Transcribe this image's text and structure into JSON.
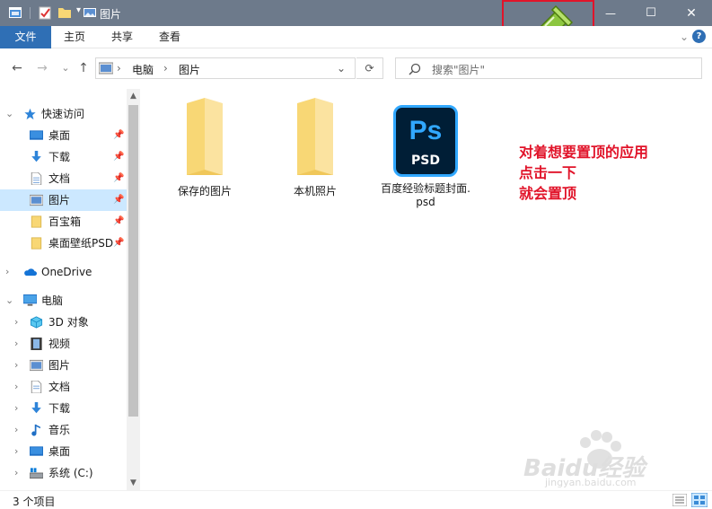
{
  "window": {
    "title": "图片",
    "controls": {
      "minimize": "—",
      "maximize": "☐",
      "close": "✕"
    }
  },
  "ribbon": {
    "tabs": [
      {
        "label": "文件",
        "active": true
      },
      {
        "label": "主页"
      },
      {
        "label": "共享"
      },
      {
        "label": "查看"
      }
    ],
    "collapse_glyph": "⌄",
    "help_glyph": "?"
  },
  "navigation": {
    "back": "←",
    "forward": "→",
    "recent": "⌄",
    "up": "↑",
    "breadcrumb": [
      "电脑",
      "图片"
    ],
    "separator": "›",
    "dropdown": "⌄",
    "refresh": "⟳"
  },
  "search": {
    "placeholder": "搜索\"图片\""
  },
  "sidebar": {
    "quick_access": {
      "label": "快速访问",
      "items": [
        {
          "label": "桌面",
          "icon": "desktop-icon",
          "pinned": true
        },
        {
          "label": "下载",
          "icon": "download-icon",
          "pinned": true
        },
        {
          "label": "文档",
          "icon": "document-icon",
          "pinned": true
        },
        {
          "label": "图片",
          "icon": "pictures-icon",
          "pinned": true,
          "selected": true
        },
        {
          "label": "百宝箱",
          "icon": "folder-icon",
          "pinned": true
        },
        {
          "label": "桌面壁纸PSD",
          "icon": "folder-icon",
          "pinned": true
        }
      ]
    },
    "onedrive": {
      "label": "OneDrive"
    },
    "this_pc": {
      "label": "电脑",
      "items": [
        {
          "label": "3D 对象",
          "icon": "3d-objects-icon"
        },
        {
          "label": "视频",
          "icon": "video-icon"
        },
        {
          "label": "图片",
          "icon": "pictures-icon"
        },
        {
          "label": "文档",
          "icon": "document-icon"
        },
        {
          "label": "下载",
          "icon": "download-icon"
        },
        {
          "label": "音乐",
          "icon": "music-icon"
        },
        {
          "label": "桌面",
          "icon": "desktop-icon"
        },
        {
          "label": "系统 (C:)",
          "icon": "drive-icon"
        }
      ]
    }
  },
  "files": [
    {
      "name": "保存的图片",
      "type": "folder"
    },
    {
      "name": "本机照片",
      "type": "folder"
    },
    {
      "name": "百度经验标题封面.psd",
      "type": "psd",
      "badge": "Ps",
      "ext_label": "PSD"
    }
  ],
  "annotation": {
    "lines": [
      "对着想要置顶的应用",
      "点击一下",
      "就会置顶"
    ],
    "color": "#e1142a"
  },
  "status": {
    "item_count": "3 个项目"
  },
  "watermark": {
    "text": "Baidu经验",
    "url": "jingyan.baidu.com"
  },
  "colors": {
    "titlebar": "#6d7a8b",
    "file_tab": "#2f6fb5",
    "selection": "#cce8ff",
    "folder": "#f8d775",
    "psd_bg": "#001e36",
    "psd_accent": "#31a8ff"
  }
}
